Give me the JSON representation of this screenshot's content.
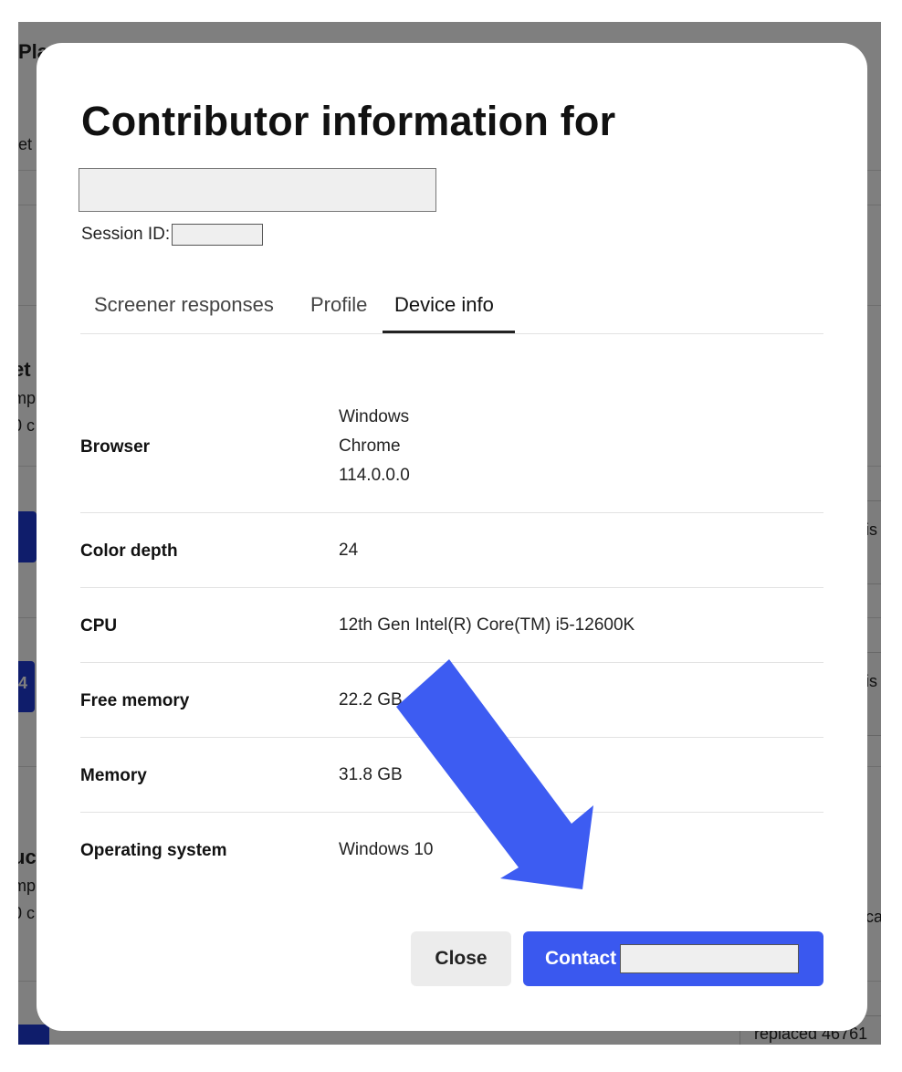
{
  "background": {
    "title_fragment": "Pla",
    "subtitle_fragment": "et",
    "section1_fragments": [
      "et",
      "mp",
      "0 c"
    ],
    "section2_fragments": [
      "uct",
      "mp",
      "0 c"
    ],
    "badge_fragment": "4",
    "right_fragments": [
      "is",
      "is",
      "ca"
    ],
    "bottom_right_text": "replaced 46761"
  },
  "modal": {
    "title": "Contributor information for",
    "session_label": "Session ID:",
    "tabs": [
      {
        "label": "Screener responses",
        "active": false
      },
      {
        "label": "Profile",
        "active": false
      },
      {
        "label": "Device info",
        "active": true
      }
    ],
    "rows": [
      {
        "label": "Browser",
        "values": [
          "Windows",
          "Chrome",
          "114.0.0.0"
        ]
      },
      {
        "label": "Color depth",
        "values": [
          "24"
        ]
      },
      {
        "label": "CPU",
        "values": [
          "12th Gen Intel(R) Core(TM) i5-12600K"
        ]
      },
      {
        "label": "Free memory",
        "values": [
          "22.2 GB"
        ]
      },
      {
        "label": "Memory",
        "values": [
          "31.8 GB"
        ]
      },
      {
        "label": "Operating system",
        "values": [
          "Windows 10"
        ]
      }
    ],
    "close_label": "Close",
    "contact_label": "Contact"
  },
  "colors": {
    "accent": "#3a58ef",
    "arrow": "#3d5cf2"
  },
  "icons": [
    "arrow-annotation-icon"
  ]
}
